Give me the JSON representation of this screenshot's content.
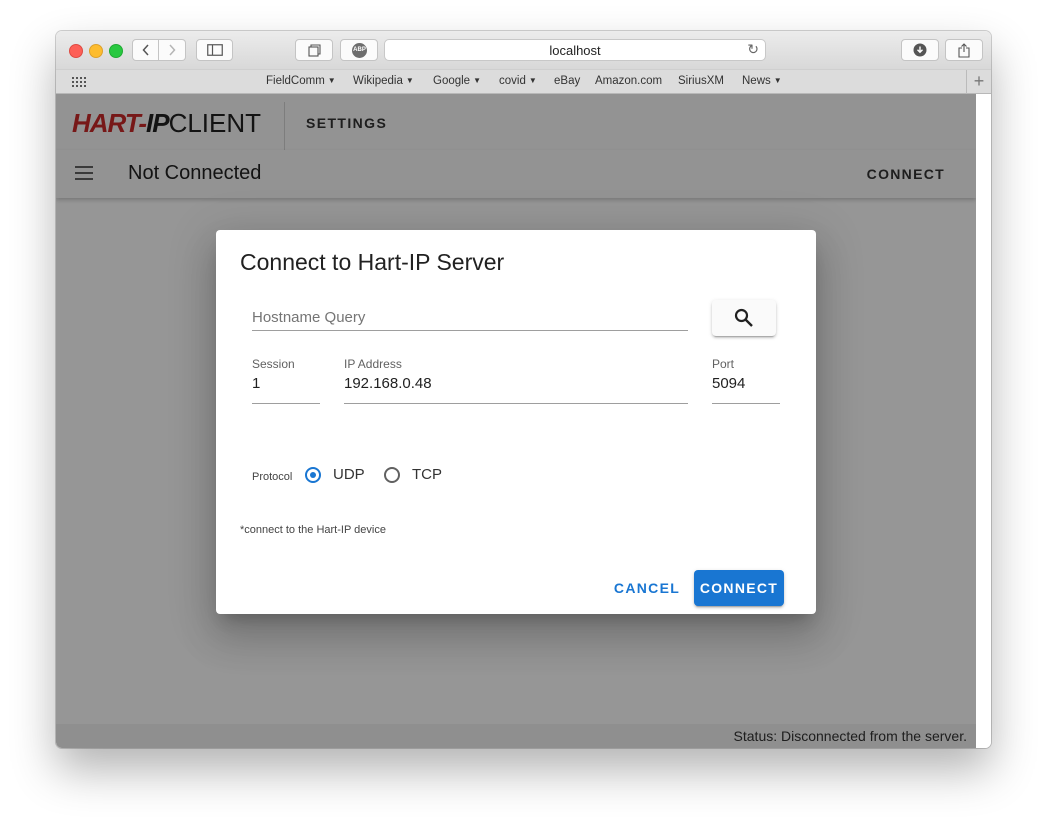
{
  "browser": {
    "url": "localhost",
    "abp_label": "ABP",
    "bookmarks": [
      {
        "label": "FieldComm",
        "dropdown": true
      },
      {
        "label": "Wikipedia",
        "dropdown": true
      },
      {
        "label": "Google",
        "dropdown": true
      },
      {
        "label": "covid",
        "dropdown": true
      },
      {
        "label": "eBay",
        "dropdown": false
      },
      {
        "label": "Amazon.com",
        "dropdown": false
      },
      {
        "label": "SiriusXM",
        "dropdown": false
      },
      {
        "label": "News",
        "dropdown": true
      }
    ]
  },
  "app": {
    "logo": {
      "hart": "HART",
      "dash": "-",
      "ip": "IP",
      "client": "CLIENT"
    },
    "settings_tab": "SETTINGS",
    "connection_title": "Not Connected",
    "connect_action": "CONNECT",
    "footer_status": "Status: Disconnected from the server."
  },
  "dialog": {
    "title": "Connect to Hart-IP Server",
    "hostname_placeholder": "Hostname Query",
    "session": {
      "label": "Session",
      "value": "1"
    },
    "ip_address": {
      "label": "IP Address",
      "value": "192.168.0.48"
    },
    "port": {
      "label": "Port",
      "value": "5094"
    },
    "protocol": {
      "label": "Protocol",
      "options": [
        "UDP",
        "TCP"
      ],
      "selected": "UDP"
    },
    "hint": "*connect to the Hart-IP device",
    "cancel_label": "CANCEL",
    "connect_label": "CONNECT"
  },
  "colors": {
    "primary": "#1976d2",
    "logo_red": "#c62828"
  }
}
